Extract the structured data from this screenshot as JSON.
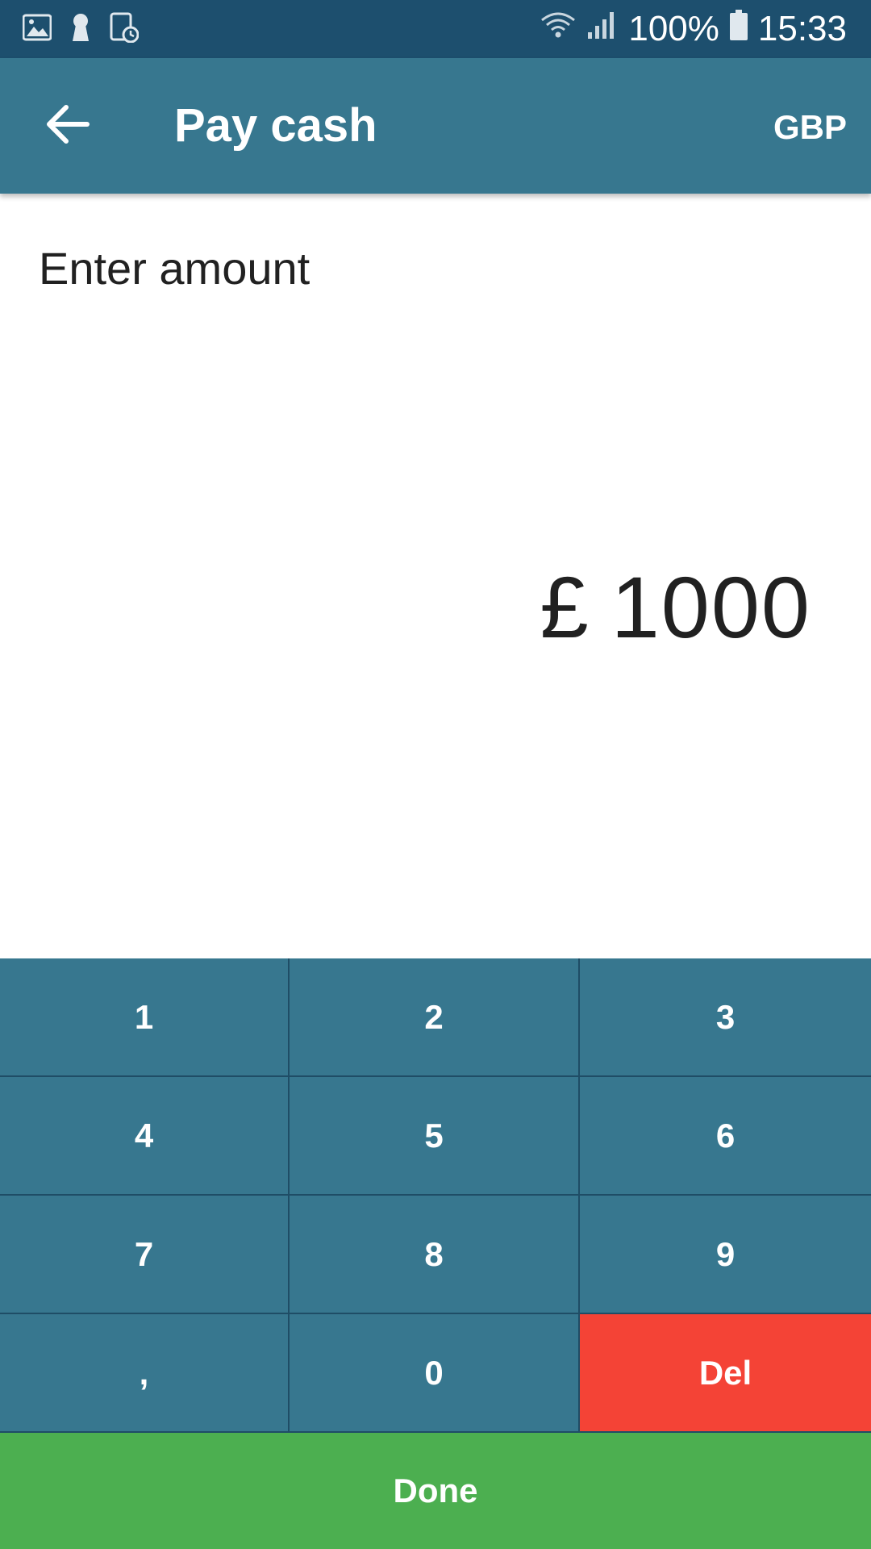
{
  "status_bar": {
    "battery": "100%",
    "time": "15:33",
    "icons_left": [
      "image-icon",
      "keyhole-icon",
      "clock-clipboard-icon"
    ],
    "icons_right": [
      "wifi-icon",
      "signal-icon",
      "battery-icon"
    ]
  },
  "app_bar": {
    "back_icon": "arrow-left-icon",
    "title": "Pay cash",
    "currency": "GBP"
  },
  "content": {
    "label": "Enter amount",
    "currency_symbol": "£",
    "amount": "1000"
  },
  "keypad": {
    "keys": [
      "1",
      "2",
      "3",
      "4",
      "5",
      "6",
      "7",
      "8",
      "9",
      ",",
      "0",
      "Del"
    ]
  },
  "done_label": "Done",
  "colors": {
    "status_bar": "#1d4f6e",
    "primary": "#37778f",
    "delete": "#f44336",
    "done": "#4caf50"
  }
}
